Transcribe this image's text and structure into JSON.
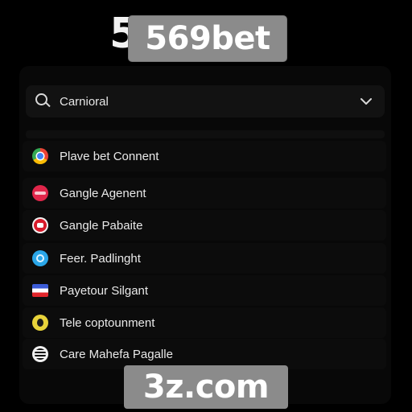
{
  "logo": {
    "back_white": "56",
    "back_red": "9",
    "overlay": "569bet"
  },
  "search": {
    "value": "Carnioral",
    "icon": "search-icon",
    "dropdown_icon": "chevron-down-icon"
  },
  "list": {
    "items": [
      {
        "label": "Plave bet Connent",
        "icon": "chrome-icon"
      },
      {
        "label": "Gangle Agenent",
        "icon": "red-app-icon"
      },
      {
        "label": "Gangle Pabaite",
        "icon": "red-circle-icon"
      },
      {
        "label": "Feer. Padlinght",
        "icon": "blue-circle-icon"
      },
      {
        "label": "Payetour Silgant",
        "icon": "flag-icon"
      },
      {
        "label": "Tele coptounment",
        "icon": "yellow-face-icon"
      },
      {
        "label": "Care Mahefa Pagalle",
        "icon": "globe-icon"
      }
    ]
  },
  "watermark": {
    "domain": "3z.com"
  },
  "colors": {
    "background": "#000000",
    "panel": "#080808",
    "accent_red": "#e01818",
    "pill_gray": "#8b8b8b"
  }
}
